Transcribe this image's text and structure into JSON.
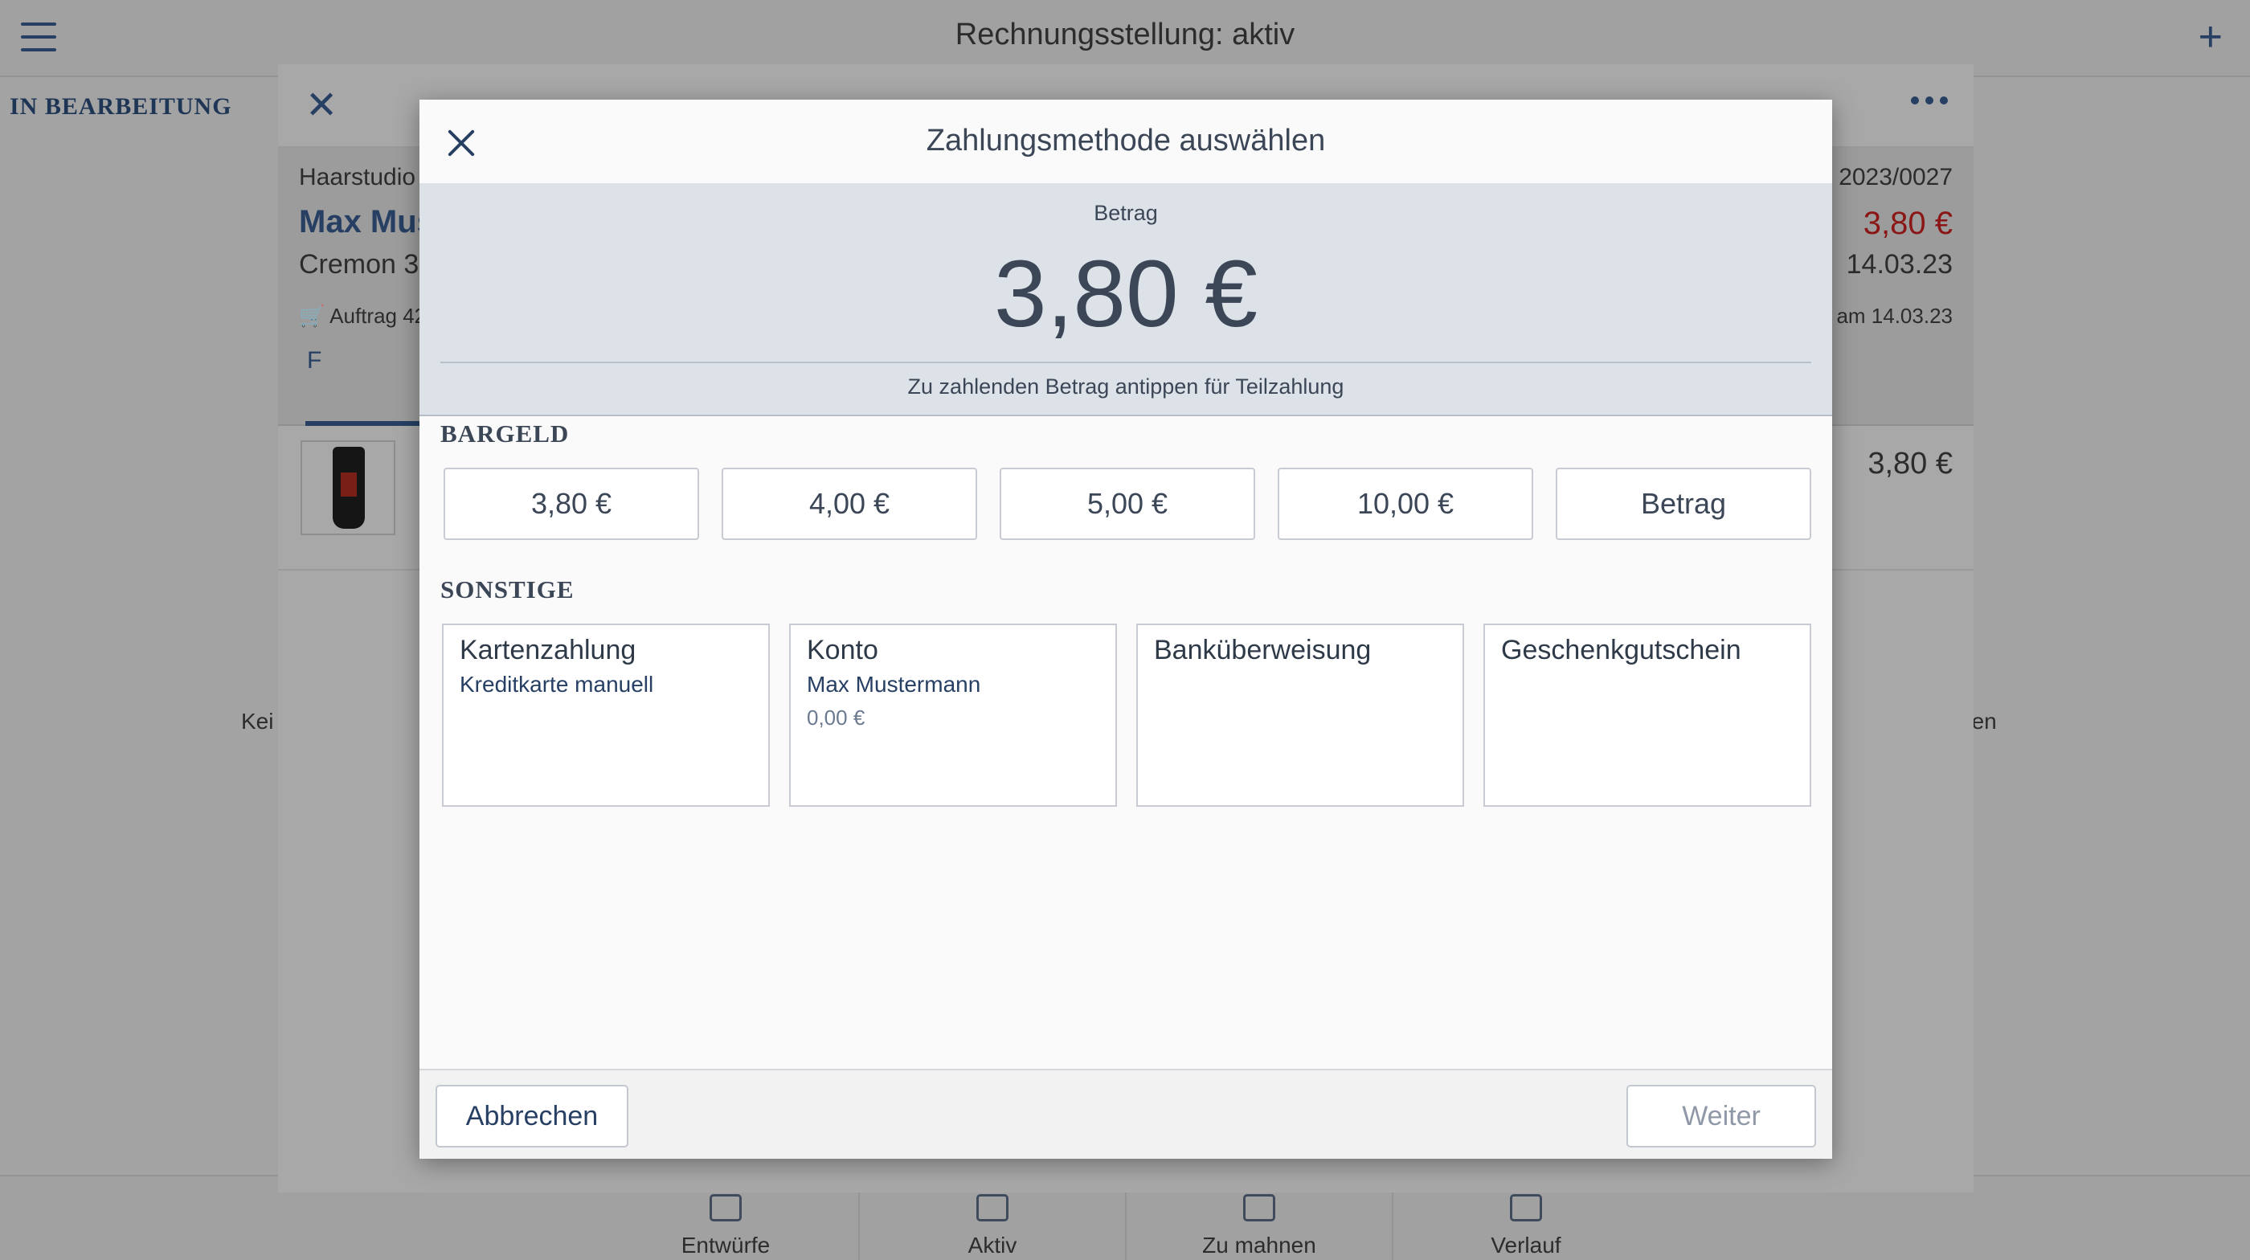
{
  "app": {
    "title": "Rechnungsstellung: aktiv",
    "add_label": "+",
    "section_label": "IN BEARBEITUNG",
    "empty_left": "Kei",
    "empty_right": "den"
  },
  "invoice": {
    "shop": "Haarstudio",
    "number": "2023/0027",
    "customer": "Max Mus",
    "total": "3,80 €",
    "address": "Cremon 3,",
    "date": "14.03.23",
    "order": "Auftrag 42",
    "due": "am 14.03.23",
    "tab_label": "F",
    "item_price": "3,80 €"
  },
  "bottom_nav": {
    "items": [
      {
        "label": "Entwürfe",
        "icon": "receipt-icon"
      },
      {
        "label": "Aktiv",
        "icon": "receipt-check-icon"
      },
      {
        "label": "Zu mahnen",
        "icon": "receipt-alert-icon"
      },
      {
        "label": "Verlauf",
        "icon": "receipt-history-icon"
      }
    ]
  },
  "modal": {
    "title": "Zahlungsmethode auswählen",
    "amount_label": "Betrag",
    "amount_value": "3,80 €",
    "amount_hint": "Zu zahlenden Betrag antippen für Teilzahlung",
    "cash_section": "BARGELD",
    "cash_options": [
      "3,80 €",
      "4,00 €",
      "5,00 €",
      "10,00 €",
      "Betrag"
    ],
    "other_section": "SONSTIGE",
    "other_options": [
      {
        "title": "Kartenzahlung",
        "subtitle": "Kreditkarte manuell",
        "detail": ""
      },
      {
        "title": "Konto",
        "subtitle": "Max Mustermann",
        "detail": "0,00 €"
      },
      {
        "title": "Banküberweisung",
        "subtitle": "",
        "detail": ""
      },
      {
        "title": "Geschenkgutschein",
        "subtitle": "",
        "detail": ""
      }
    ],
    "cancel_label": "Abbrechen",
    "next_label": "Weiter"
  },
  "colors": {
    "brand": "#263f63",
    "amount_bg": "#dde2e9",
    "total_red": "#8a1616"
  }
}
